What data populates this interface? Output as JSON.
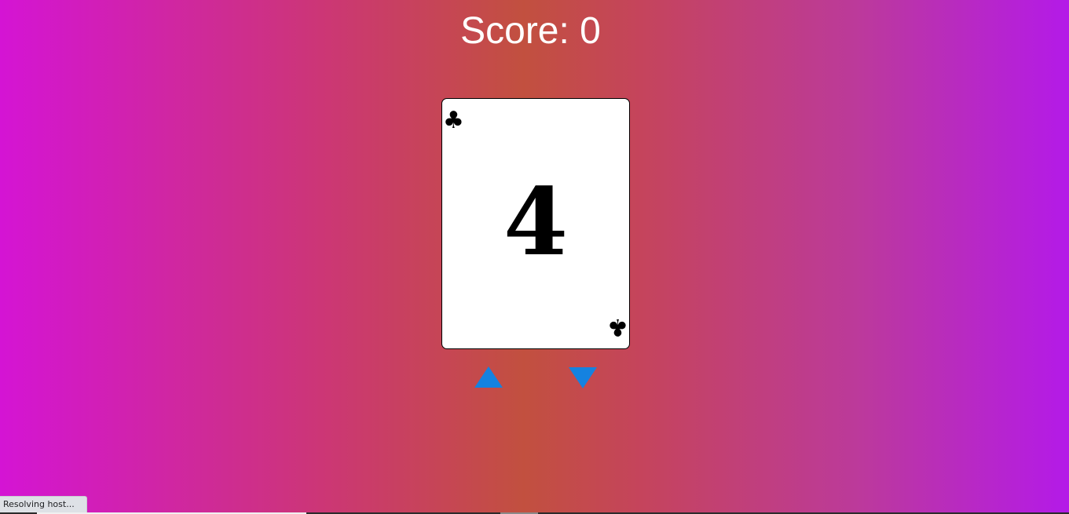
{
  "score": {
    "text": "Score: 0"
  },
  "card": {
    "rank": "4",
    "suit_icon": "club-icon",
    "suit_glyph": "♣"
  },
  "controls": {
    "higher": {
      "icon": "triangle-up-icon",
      "color": "#1582e0"
    },
    "lower": {
      "icon": "triangle-down-icon",
      "color": "#1582e0"
    }
  },
  "status_bar": {
    "text": "Resolving host..."
  }
}
